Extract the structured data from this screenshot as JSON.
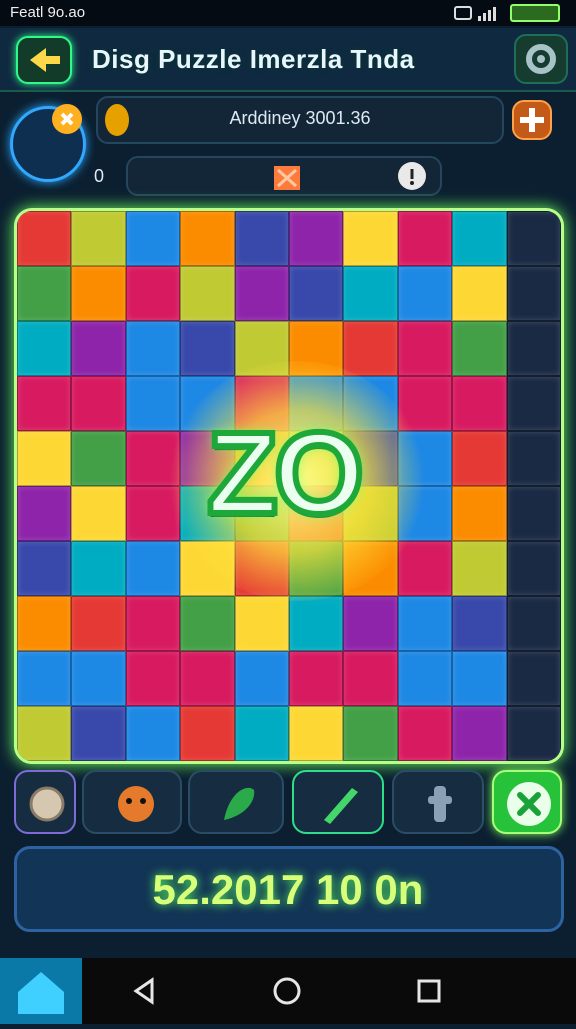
{
  "status_bar": {
    "text": "Featl 9o.ao"
  },
  "header": {
    "title": "Disg Puzzle Imerzla Tnda"
  },
  "info_row": {
    "label": "Arddiney 3001.36",
    "counter": "0"
  },
  "board": {
    "center_text": "ZO"
  },
  "score_bar": {
    "text": "52.2017 10 0n"
  },
  "colors": {
    "accent_green": "#7dff5a",
    "brand_blue": "#2d63a0",
    "board_border": "#b8ff8a"
  },
  "icons": [
    "back-arrow-icon",
    "gear-icon",
    "close-badge-icon",
    "gem-icon",
    "plus-icon",
    "puzzle-piece-icon",
    "info-icon",
    "coin-icon",
    "face-icon",
    "leaf-icon",
    "pencil-icon",
    "pin-icon",
    "check-icon",
    "home-icon",
    "back-icon",
    "circle-home-icon",
    "recent-apps-icon"
  ]
}
